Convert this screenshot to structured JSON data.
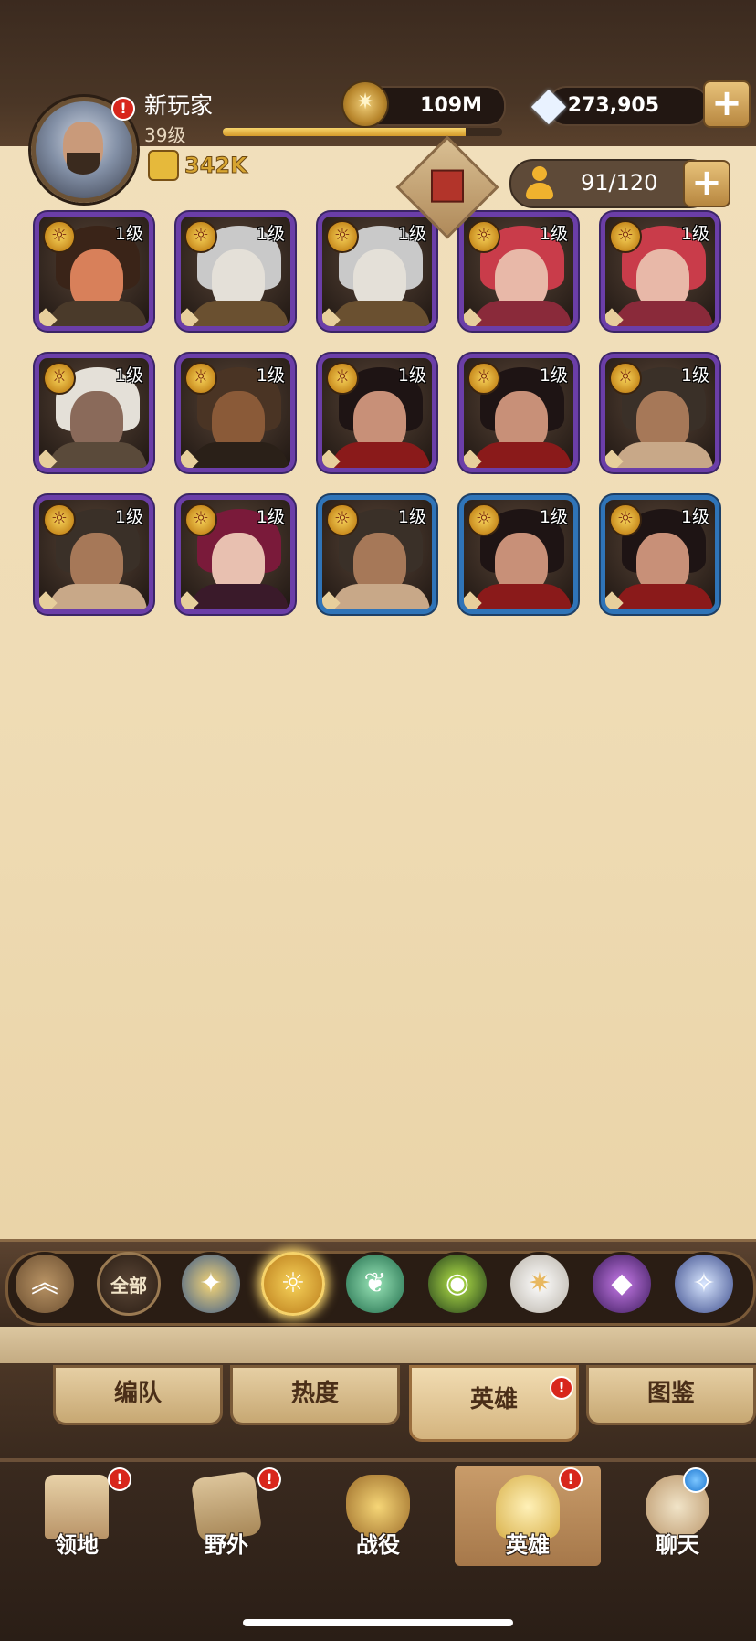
{
  "player": {
    "name": "新玩家",
    "level": "39级",
    "power": "342K",
    "xp_progress": 0.87
  },
  "currency": {
    "gold": "109M",
    "diamonds": "273,905"
  },
  "roster": {
    "count": "91/120"
  },
  "heroes": [
    {
      "level": "1级",
      "rarity": "purple",
      "icon": "lion-warrior"
    },
    {
      "level": "1级",
      "rarity": "purple",
      "icon": "eagle-warrior"
    },
    {
      "level": "1级",
      "rarity": "purple",
      "icon": "eagle-warrior"
    },
    {
      "level": "1级",
      "rarity": "purple",
      "icon": "red-haired-girl"
    },
    {
      "level": "1级",
      "rarity": "purple",
      "icon": "red-haired-girl"
    },
    {
      "level": "1级",
      "rarity": "purple",
      "icon": "white-haired-elder"
    },
    {
      "level": "1级",
      "rarity": "purple",
      "icon": "hound-warrior"
    },
    {
      "level": "1级",
      "rarity": "purple",
      "icon": "dark-haired-woman"
    },
    {
      "level": "1级",
      "rarity": "purple",
      "icon": "dark-haired-woman"
    },
    {
      "level": "1级",
      "rarity": "purple",
      "icon": "tattooed-warrior"
    },
    {
      "level": "1级",
      "rarity": "purple",
      "icon": "tattooed-warrior"
    },
    {
      "level": "1级",
      "rarity": "purple",
      "icon": "fox-eared-girl"
    },
    {
      "level": "1级",
      "rarity": "blue",
      "icon": "tattooed-warrior"
    },
    {
      "level": "1级",
      "rarity": "blue",
      "icon": "dark-haired-woman"
    },
    {
      "level": "1级",
      "rarity": "blue",
      "icon": "dark-haired-woman"
    }
  ],
  "factions": {
    "all_label": "全部",
    "items": [
      "collapse-chevron-icon",
      "all",
      "star-compass-icon",
      "sun-faction-icon",
      "leaf-faction-icon",
      "eye-faction-icon",
      "light-faction-icon",
      "dark-faction-icon",
      "arcane-faction-icon"
    ],
    "selected": "sun-faction-icon"
  },
  "subtabs": [
    "编队",
    "热度",
    "英雄",
    "图鉴"
  ],
  "subtab_active": "英雄",
  "nav": [
    {
      "label": "领地",
      "icon": "castle-icon",
      "alert": true
    },
    {
      "label": "野外",
      "icon": "scroll-map-icon",
      "alert": true
    },
    {
      "label": "战役",
      "icon": "sword-emblem-icon",
      "alert": false
    },
    {
      "label": "英雄",
      "icon": "helmet-icon",
      "alert": true,
      "active": true
    },
    {
      "label": "聊天",
      "icon": "chat-bubble-icon",
      "alert": false,
      "blue_dot": true
    }
  ],
  "colors": {
    "rarity_purple": "#6b3ea8",
    "rarity_blue": "#2f74b8",
    "alert_red": "#d8261c",
    "power_gold": "#d7a531"
  }
}
